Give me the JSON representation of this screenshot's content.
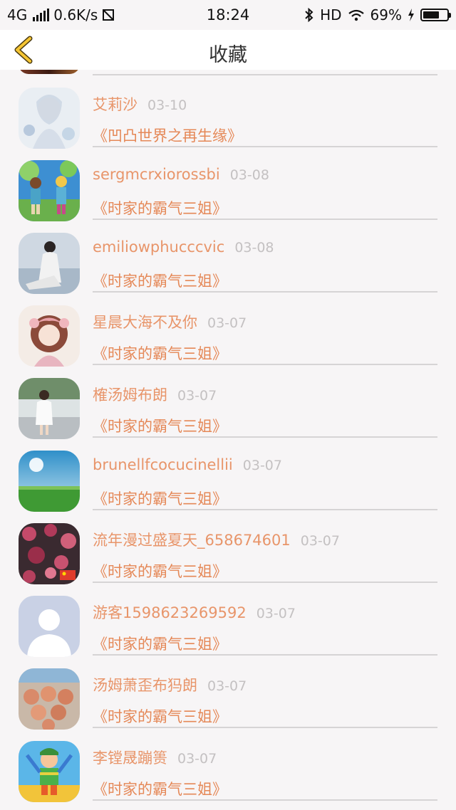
{
  "status_bar": {
    "network": "4G",
    "speed": "0.6K/s",
    "time": "18:24",
    "hd": "HD",
    "battery": "69%",
    "battery_level": 0.69
  },
  "nav": {
    "title": "收藏"
  },
  "items": [
    {
      "name": "艾莉沙",
      "date": "03-10",
      "work": "《凹凸世界之再生缘》"
    },
    {
      "name": "sergmcrxiorossbi",
      "date": "03-08",
      "work": "《时家的霸气三姐》"
    },
    {
      "name": "emiliowphucccvic",
      "date": "03-08",
      "work": "《时家的霸气三姐》"
    },
    {
      "name": "星晨大海不及你",
      "date": "03-07",
      "work": "《时家的霸气三姐》"
    },
    {
      "name": "榷汤姆布朗",
      "date": "03-07",
      "work": "《时家的霸气三姐》"
    },
    {
      "name": "brunellfcocucinellii",
      "date": "03-07",
      "work": "《时家的霸气三姐》"
    },
    {
      "name": "流年漫过盛夏天_658674601",
      "date": "03-07",
      "work": "《时家的霸气三姐》"
    },
    {
      "name": "游客1598623269592",
      "date": "03-07",
      "work": "《时家的霸气三姐》"
    },
    {
      "name": "汤姆萧歪布犸朗",
      "date": "03-07",
      "work": "《时家的霸气三姐》"
    },
    {
      "name": "李镗晟蹦篑",
      "date": "03-07",
      "work": "《时家的霸气三姐》"
    }
  ]
}
